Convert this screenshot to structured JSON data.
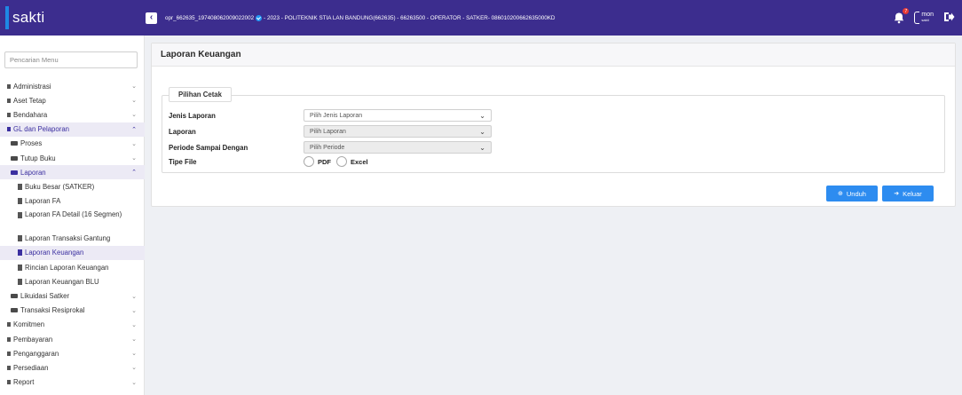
{
  "app": {
    "title": "sakti"
  },
  "topbar": {
    "session_left": "opr_662635_197408062009022002",
    "session_right": "- 2023 - POLITEKNIK STIA LAN BANDUNG(662635) - 66263500 - OPERATOR - SATKER- 086010200662635000KD",
    "notif_count": "7",
    "mon_logo_text": "mon",
    "mon_logo_sub": "sakti",
    "icons": {
      "toggle": "chevron-left-icon",
      "bell": "bell-icon",
      "logout": "logout-icon"
    }
  },
  "sidebar": {
    "search_placeholder": "Pencarian Menu",
    "items": [
      {
        "label": "Administrasi"
      },
      {
        "label": "Aset Tetap"
      },
      {
        "label": "Bendahara"
      },
      {
        "label": "GL dan Pelaporan"
      },
      {
        "label": "Proses"
      },
      {
        "label": "Tutup Buku"
      },
      {
        "label": "Laporan"
      },
      {
        "label": "Buku Besar (SATKER)"
      },
      {
        "label": "Laporan FA"
      },
      {
        "label": "Laporan FA Detail (16 Segmen)"
      },
      {
        "label": "Laporan Transaksi Gantung"
      },
      {
        "label": "Laporan Keuangan"
      },
      {
        "label": "Rincian Laporan Keuangan"
      },
      {
        "label": "Laporan Keuangan BLU"
      },
      {
        "label": "Likuidasi Satker"
      },
      {
        "label": "Transaksi Resiprokal"
      },
      {
        "label": "Komitmen"
      },
      {
        "label": "Pembayaran"
      },
      {
        "label": "Penganggaran"
      },
      {
        "label": "Persediaan"
      },
      {
        "label": "Report"
      }
    ]
  },
  "main": {
    "title": "Laporan Keuangan",
    "legend": "Pilihan Cetak",
    "fields": {
      "jenis": {
        "label": "Jenis Laporan",
        "value": "Pilih Jenis Laporan"
      },
      "laporan": {
        "label": "Laporan",
        "value": "Pilih Laporan"
      },
      "periode": {
        "label": "Periode Sampai Dengan",
        "value": "Pilih Periode"
      },
      "tipe": {
        "label": "Tipe File",
        "opt_pdf": "PDF",
        "opt_excel": "Excel"
      }
    },
    "buttons": {
      "unduh": "Unduh",
      "keluar": "Keluar"
    }
  },
  "colors": {
    "topbar": "#3c2d8e",
    "accent": "#2d8cf0",
    "active_menu": "#3b2fa0"
  }
}
